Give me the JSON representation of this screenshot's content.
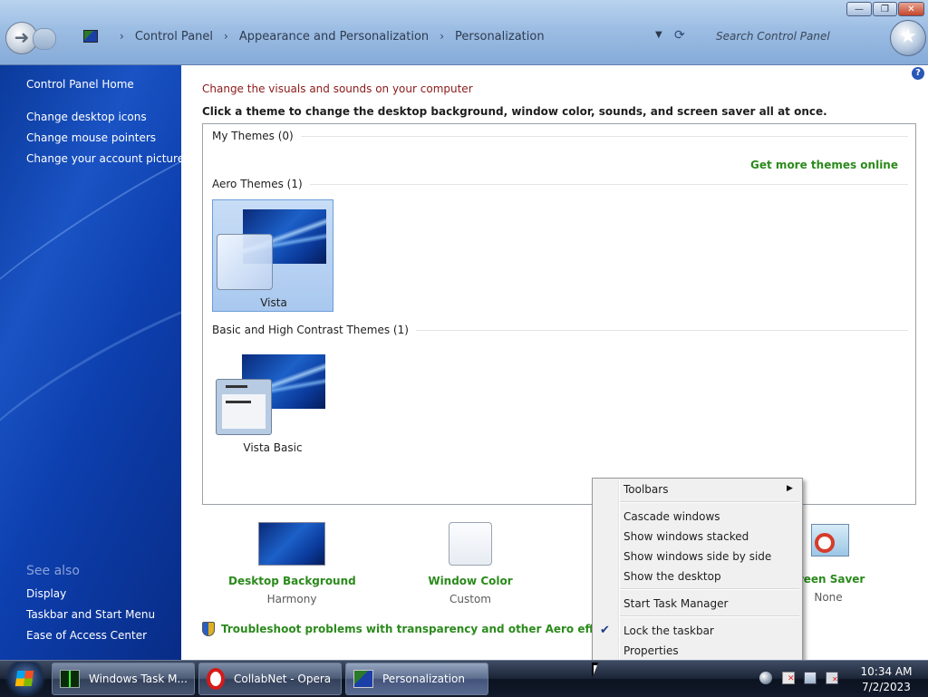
{
  "window": {
    "minimize_label": "—",
    "maximize_label": "❐",
    "close_label": "✕"
  },
  "address_bar": {
    "breadcrumbs": [
      "Control Panel",
      "Appearance and Personalization",
      "Personalization"
    ],
    "separator": "›",
    "search_placeholder": "Search Control Panel"
  },
  "left_nav": {
    "items": [
      "Control Panel Home",
      "Change desktop icons",
      "Change mouse pointers",
      "Change your account picture"
    ],
    "see_also_title": "See also",
    "see_also_items": [
      "Display",
      "Taskbar and Start Menu",
      "Ease of Access Center"
    ]
  },
  "main": {
    "help": "?",
    "heading": "Change the visuals and sounds on your computer",
    "subheading": "Click a theme to change the desktop background, window color, sounds, and screen saver all at once.",
    "groups": {
      "my_themes": "My Themes (0)",
      "get_more": "Get more themes online",
      "aero": "Aero Themes (1)",
      "basic": "Basic and High Contrast Themes (1)"
    },
    "themes": [
      {
        "name": "Vista",
        "selected": true
      },
      {
        "name": "Vista Basic",
        "selected": false
      }
    ],
    "settings": [
      {
        "name": "Desktop Background",
        "value": "Harmony"
      },
      {
        "name": "Window Color",
        "value": "Custom"
      },
      {
        "name": "creen Saver",
        "value": "None"
      }
    ],
    "troubleshoot": "Troubleshoot problems with transparency and other Aero effects"
  },
  "context_menu": {
    "toolbars": "Toolbars",
    "cascade": "Cascade windows",
    "stacked": "Show windows stacked",
    "side_by_side": "Show windows side by side",
    "show_desktop": "Show the desktop",
    "task_manager": "Start Task Manager",
    "lock_taskbar": "Lock the taskbar",
    "lock_checked": true,
    "properties": "Properties"
  },
  "taskbar": {
    "buttons": [
      "Windows Task M...",
      "CollabNet - Opera",
      "Personalization"
    ],
    "active_button": "Personalization",
    "clock_time": "10:34 AM",
    "clock_date": "7/2/2023"
  },
  "colors": {
    "link_green": "#2b8a1c",
    "heading_red": "#8b1a1a",
    "nav_blue": "#1a53c4"
  }
}
